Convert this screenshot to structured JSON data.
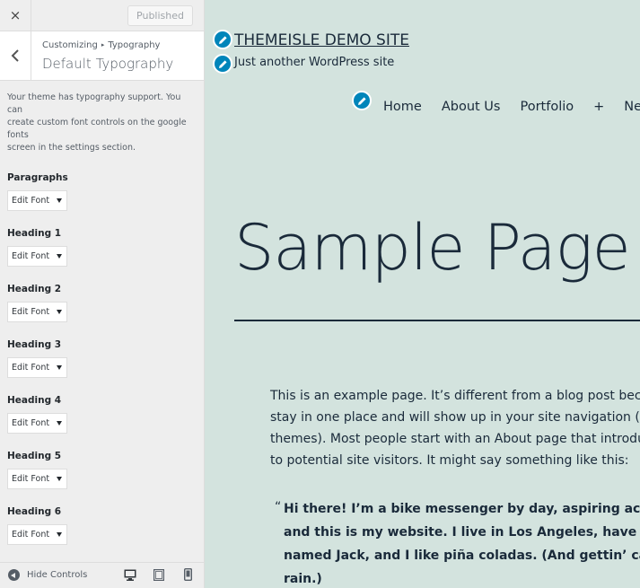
{
  "sidebar": {
    "close_icon": "×",
    "publish_label": "Published",
    "breadcrumb": {
      "parent": "Customizing",
      "separator": "▸",
      "current": "Typography"
    },
    "section_title": "Default Typography",
    "description_lines": [
      "Your theme has typography support. You can",
      "create custom font controls on the google fonts",
      "screen in the settings section."
    ],
    "controls": [
      {
        "label": "Paragraphs",
        "button": "Edit Font"
      },
      {
        "label": "Heading 1",
        "button": "Edit Font"
      },
      {
        "label": "Heading 2",
        "button": "Edit Font"
      },
      {
        "label": "Heading 3",
        "button": "Edit Font"
      },
      {
        "label": "Heading 4",
        "button": "Edit Font"
      },
      {
        "label": "Heading 5",
        "button": "Edit Font"
      },
      {
        "label": "Heading 6",
        "button": "Edit Font"
      }
    ],
    "footer": {
      "hide_controls_label": "Hide Controls",
      "devices": [
        "desktop",
        "tablet",
        "mobile"
      ]
    }
  },
  "preview": {
    "site_title": "THEMEISLE DEMO SITE",
    "tagline": "Just another WordPress site",
    "nav": [
      "Home",
      "About Us",
      "Portfolio",
      "+",
      "News"
    ],
    "page_title": "Sample Page",
    "body_lines": [
      "This is an example page. It’s different from a blog post becaus",
      "stay in one place and will show up in your site navigation (in m",
      "themes). Most people start with an About page that introduce",
      "to potential site visitors. It might say something like this:"
    ],
    "quote_mark": "“",
    "quote_lines": [
      "Hi there! I’m a bike messenger by day, aspiring actor by",
      "and this is my website. I live in Los Angeles, have a grea",
      "named Jack, and I like piña coladas. (And gettin’ caught",
      "rain.)"
    ],
    "accent_color": "#0085ba",
    "background_color": "#d3e3de"
  }
}
